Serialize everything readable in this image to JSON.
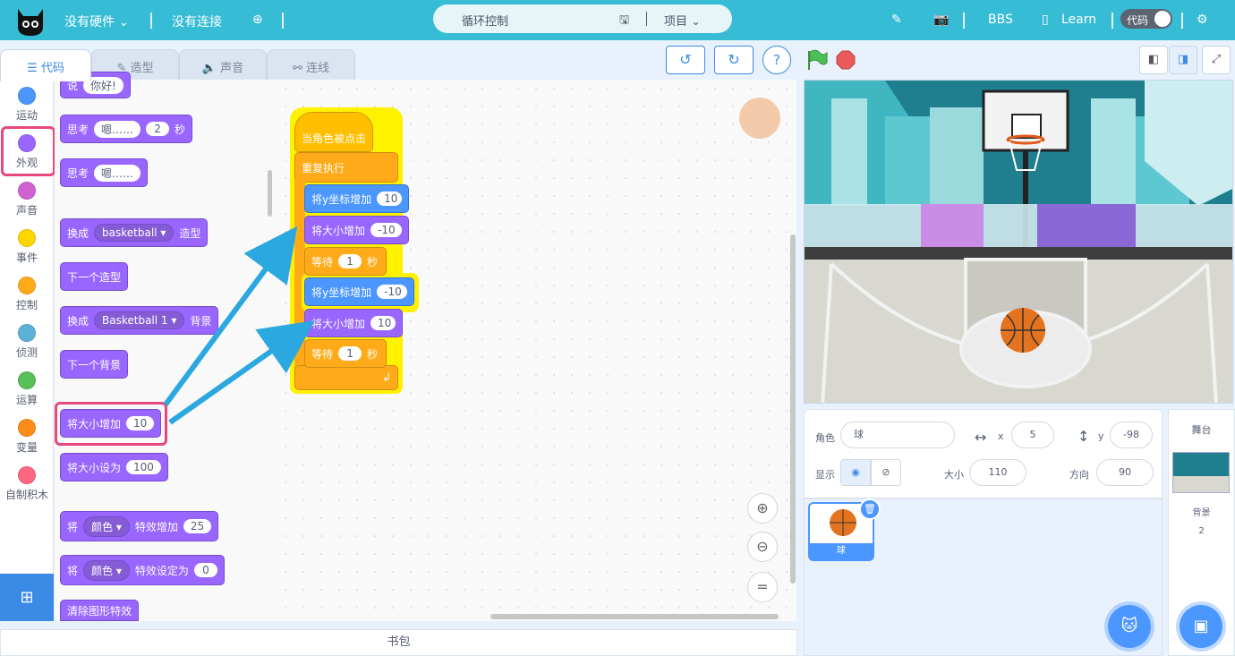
{
  "topbar": {
    "hardware": "没有硬件",
    "connection": "没有连接",
    "project_title": "循环控制",
    "project_menu": "项目",
    "bbs": "BBS",
    "learn": "Learn",
    "mode_toggle": "代码"
  },
  "tabs": {
    "code": "代码",
    "costumes": "造型",
    "sounds": "声音",
    "connect": "连线"
  },
  "categories": [
    {
      "label": "运动",
      "color": "#4c97ff"
    },
    {
      "label": "外观",
      "color": "#9966ff"
    },
    {
      "label": "声音",
      "color": "#cf63cf"
    },
    {
      "label": "事件",
      "color": "#ffd500"
    },
    {
      "label": "控制",
      "color": "#ffab19"
    },
    {
      "label": "侦测",
      "color": "#5cb1d6"
    },
    {
      "label": "运算",
      "color": "#59c059"
    },
    {
      "label": "变量",
      "color": "#ff8c1a"
    },
    {
      "label": "自制积木",
      "color": "#ff6680"
    }
  ],
  "palette": {
    "say": "说",
    "say_value": "你好!",
    "think_secs": "思考",
    "think_secs_value": "嗯……",
    "think_secs_num": "2",
    "secs": "秒",
    "think": "思考",
    "think_value": "嗯……",
    "switch_costume": "换成",
    "costume_value": "basketball",
    "costume": "造型",
    "next_costume": "下一个造型",
    "switch_backdrop": "换成",
    "backdrop_value": "Basketball 1",
    "backdrop": "背景",
    "next_backdrop": "下一个背景",
    "change_size": "将大小增加",
    "change_size_value": "10",
    "set_size": "将大小设为",
    "set_size_value": "100",
    "effect_change_prefix": "将",
    "effect_value": "颜色",
    "effect_change": "特效增加",
    "effect_change_value": "25",
    "effect_set_prefix": "将",
    "effect_set_value": "颜色",
    "effect_set": "特效设定为",
    "effect_set_num": "0",
    "clear_effects": "清除图形特效"
  },
  "script": {
    "hat": "当角色被点击",
    "forever": "重复执行",
    "b1": "将y坐标增加",
    "b1_v": "10",
    "b2": "将大小增加",
    "b2_v": "-10",
    "b3": "等待",
    "b3_v": "1",
    "b3_u": "秒",
    "b4": "将y坐标增加",
    "b4_v": "-10",
    "b5": "将大小增加",
    "b5_v": "10",
    "b6": "等待",
    "b6_v": "1",
    "b6_u": "秒"
  },
  "sprite_info": {
    "sprite_label": "角色",
    "sprite_name": "球",
    "x_label": "x",
    "x": "5",
    "y_label": "y",
    "y": "-98",
    "show_label": "显示",
    "size_label": "大小",
    "size": "110",
    "direction_label": "方向",
    "direction": "90"
  },
  "sprite_list": {
    "sprite_name": "球"
  },
  "stage_panel": {
    "title": "舞台",
    "backdrop_label": "背景",
    "backdrop_count": "2"
  },
  "backpack": "书包",
  "colors": {
    "topbar": "#37bcd5",
    "looks": "#9966ff",
    "motion": "#4c97ff",
    "control": "#ffab19",
    "events": "#ffbf00",
    "highlight": "#e8477a"
  },
  "icons": [
    "cat-logo-icon",
    "chevron-down-icon",
    "globe-icon",
    "save-icon",
    "edit-icon",
    "camera-icon",
    "book-icon",
    "gear-icon",
    "undo-icon",
    "redo-icon",
    "help-icon",
    "green-flag-icon",
    "stop-icon",
    "small-stage-icon",
    "large-stage-icon",
    "fullscreen-icon",
    "zoom-in-icon",
    "zoom-out-icon",
    "zoom-reset-icon",
    "eye-icon",
    "eye-off-icon",
    "trash-icon",
    "add-sprite-icon",
    "add-backdrop-icon",
    "extension-icon"
  ]
}
